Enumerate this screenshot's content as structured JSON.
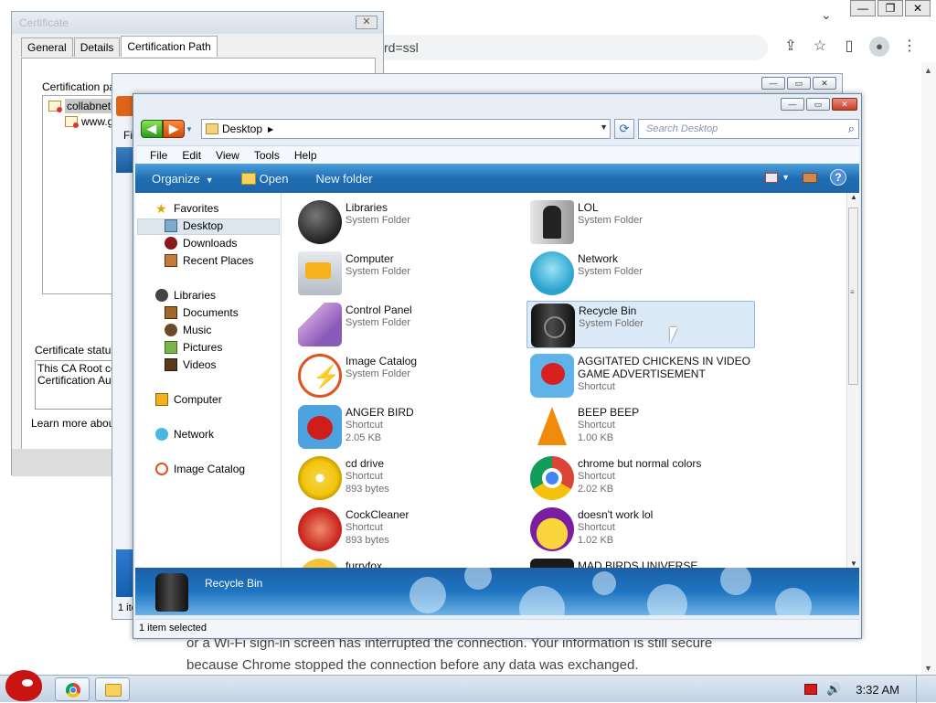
{
  "chrome": {
    "omnibox_text": "rd=ssl",
    "body_text_line1": "or a Wi-Fi sign-in screen has interrupted the connection. Your information is still secure",
    "body_text_line2": "because Chrome stopped the connection before any data was exchanged.",
    "win_min": "—",
    "win_max": "❐",
    "win_close": "✕",
    "tab_dropdown": "⌄"
  },
  "certificate": {
    "title": "Certificate",
    "tabs": [
      "General",
      "Details",
      "Certification Path"
    ],
    "active_tab": "Certification Path",
    "path_label": "Certification path",
    "tree_node1": "collabnet.lo",
    "tree_node2": "www.g",
    "status_label": "Certificate status:",
    "status_line1": "This CA Root cert",
    "status_line2": "Certification Auth",
    "learn_more": "Learn more about",
    "close": "✕"
  },
  "mid_window": {
    "menu_first": "Fi",
    "status_text": "1 ite"
  },
  "explorer": {
    "address_location": "Desktop",
    "search_placeholder": "Search Desktop",
    "menu": [
      "File",
      "Edit",
      "View",
      "Tools",
      "Help"
    ],
    "commands": {
      "organize": "Organize",
      "open": "Open",
      "new_folder": "New folder"
    },
    "nav": {
      "favorites": "Favorites",
      "desktop": "Desktop",
      "downloads": "Downloads",
      "recent_places": "Recent Places",
      "libraries": "Libraries",
      "documents": "Documents",
      "music": "Music",
      "pictures": "Pictures",
      "videos": "Videos",
      "computer": "Computer",
      "network": "Network",
      "image_catalog": "Image Catalog"
    },
    "items": [
      {
        "name": "Libraries",
        "type": "System Folder",
        "icon": "libraries-icon"
      },
      {
        "name": "LOL",
        "type": "System Folder",
        "icon": "lol-folder-icon"
      },
      {
        "name": "Computer",
        "type": "System Folder",
        "icon": "computer-icon"
      },
      {
        "name": "Network",
        "type": "System Folder",
        "icon": "network-icon"
      },
      {
        "name": "Control Panel",
        "type": "System Folder",
        "icon": "control-panel-icon"
      },
      {
        "name": "Recycle Bin",
        "type": "System Folder",
        "icon": "recycle-bin-icon",
        "selected": true
      },
      {
        "name": "Image Catalog",
        "type": "System Folder",
        "icon": "image-catalog-icon"
      },
      {
        "name": "AGGITATED CHICKENS IN VIDEO GAME ADVERTISEMENT",
        "type": "Shortcut",
        "icon": "angry-bird-icon"
      },
      {
        "name": "ANGER BIRD",
        "type": "Shortcut",
        "size": "2.05 KB",
        "icon": "angry-bird-icon"
      },
      {
        "name": "BEEP BEEP",
        "type": "Shortcut",
        "size": "1.00 KB",
        "icon": "vlc-cone-icon"
      },
      {
        "name": "cd drive",
        "type": "Shortcut",
        "size": "893 bytes",
        "icon": "cd-icon"
      },
      {
        "name": "chrome but normal colors",
        "type": "Shortcut",
        "size": "2.02 KB",
        "icon": "chrome-icon"
      },
      {
        "name": "CockCleaner",
        "type": "Shortcut",
        "size": "893 bytes",
        "icon": "ccleaner-icon"
      },
      {
        "name": "doesn't work lol",
        "type": "Shortcut",
        "size": "1.02 KB",
        "icon": "yahoo-icon"
      },
      {
        "name": "furryfox",
        "type": "",
        "icon": "folder-icon"
      },
      {
        "name": "MAD BIRDS UNIVERSE",
        "type": "",
        "icon": "game-icon"
      }
    ],
    "details_name": "Recycle Bin",
    "status": "1 item selected"
  },
  "taskbar": {
    "time": "3:32 AM"
  }
}
